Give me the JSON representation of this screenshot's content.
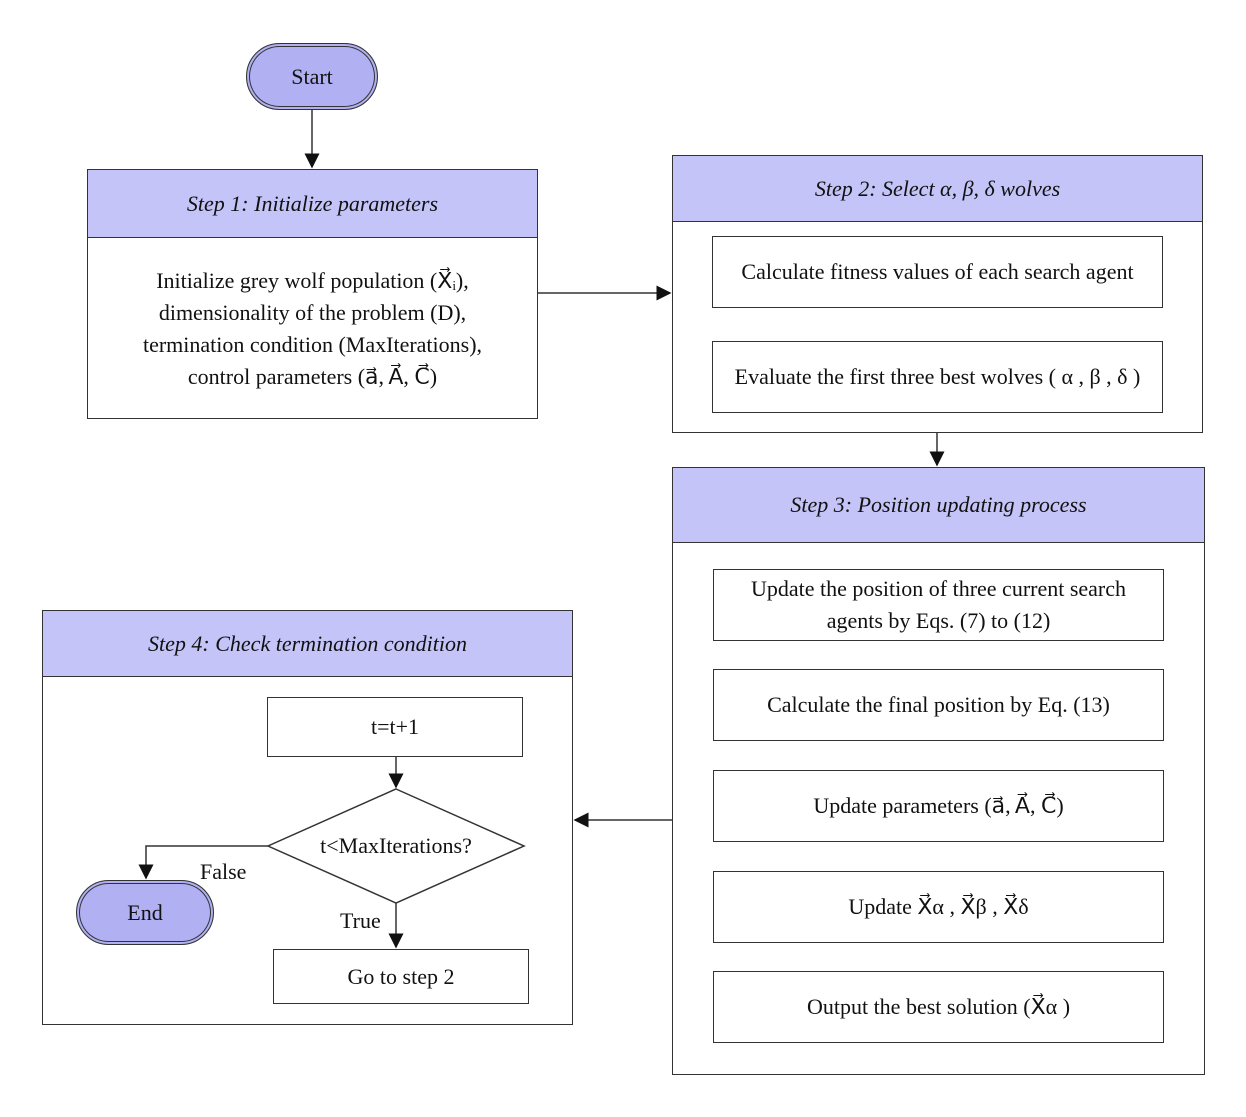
{
  "start": "Start",
  "end": "End",
  "step1": {
    "title": "Step 1: Initialize parameters",
    "lines": [
      "Initialize grey wolf population (X⃗ᵢ),",
      "dimensionality of the problem (D),",
      "termination condition (MaxIterations),",
      "control parameters (a⃗, A⃗, C⃗)"
    ]
  },
  "step2": {
    "title": "Step 2: Select α, β, δ wolves",
    "boxes": [
      "Calculate fitness values of each search agent",
      "Evaluate the first three best wolves ( α , β , δ )"
    ]
  },
  "step3": {
    "title": "Step 3: Position updating process",
    "boxes": [
      "Update the position of three current search agents by Eqs. (7) to (12)",
      "Calculate the final position by Eq. (13)",
      "Update parameters (a⃗, A⃗, C⃗)",
      "Update X⃗α , X⃗β , X⃗δ",
      "Output the best solution (X⃗α )"
    ]
  },
  "step4": {
    "title": "Step 4: Check termination condition",
    "increment": "t=t+1",
    "decision": "t<MaxIterations?",
    "true_label": "True",
    "false_label": "False",
    "goto": "Go to step 2"
  },
  "colors": {
    "header": "#C4C4F8",
    "terminal": "#B0B0F2"
  }
}
